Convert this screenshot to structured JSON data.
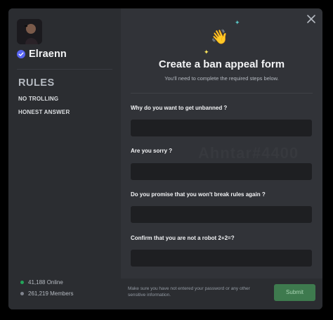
{
  "server": {
    "name": "Elraenn"
  },
  "rules": {
    "title": "RULES",
    "items": [
      "NO TROLLING",
      "HONEST ANSWER"
    ]
  },
  "stats": {
    "online": "41,188 Online",
    "members": "261,219 Members",
    "online_color": "#23a55a",
    "members_color": "#80848e"
  },
  "form": {
    "title": "Create a ban appeal form",
    "subtitle": "You'll need to complete the required steps below.",
    "questions": [
      "Why do you want to get unbanned ?",
      "Are you sorry ?",
      "Do you promise that you won't break rules again ?",
      "Confirm that you are not a robot 2+2=?"
    ],
    "watermark": "Ahntar#4400"
  },
  "footer": {
    "notice": "Make sure you have not entered your password or any other sensitive information.",
    "submit_label": "Submit"
  },
  "icons": {
    "hero": "waving-hand-icon",
    "close": "close-icon",
    "verified": "verified-badge-icon"
  }
}
